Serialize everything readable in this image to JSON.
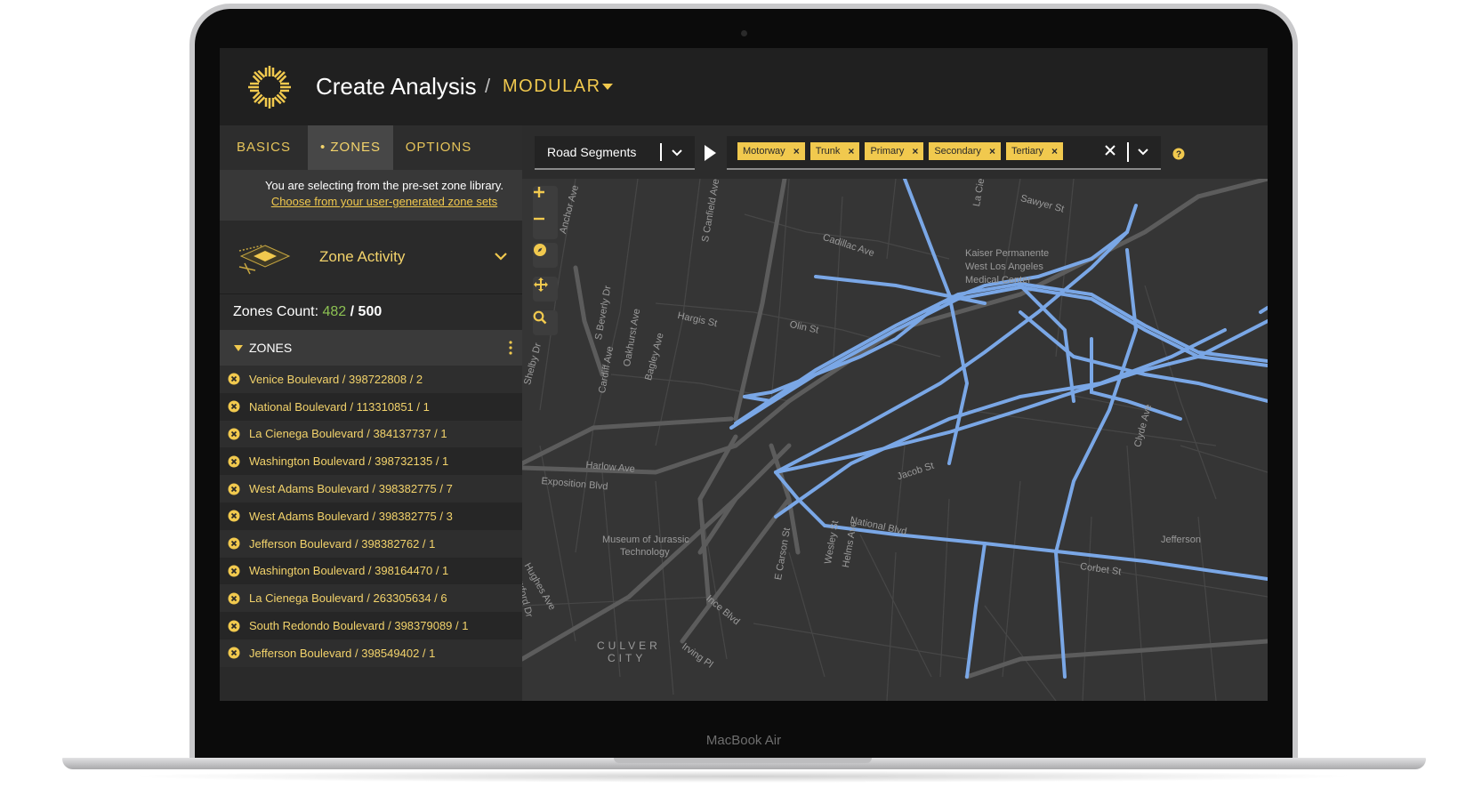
{
  "device": {
    "brand_label": "MacBook Air"
  },
  "header": {
    "title": "Create Analysis",
    "separator": "/",
    "mode": "MODULAR"
  },
  "tabs": [
    {
      "label": "BASICS"
    },
    {
      "label": "• ZONES"
    },
    {
      "label": "OPTIONS"
    }
  ],
  "notice": {
    "text": "You are selecting from the pre-set zone library.",
    "link": "Choose from your user-generated zone sets"
  },
  "activity": {
    "label": "Zone Activity"
  },
  "zones_count": {
    "prefix": "Zones Count: ",
    "current": "482",
    "separator": " / ",
    "max": "500"
  },
  "zones_section": {
    "title": "ZONES"
  },
  "zones": [
    "Venice Boulevard / 398722808 / 2",
    "National Boulevard / 113310851 / 1",
    "La Cienega Boulevard / 384137737 / 1",
    "Washington Boulevard / 398732135 / 1",
    "West Adams Boulevard / 398382775 / 7",
    "West Adams Boulevard / 398382775 / 3",
    "Jefferson Boulevard / 398382762 / 1",
    "Washington Boulevard / 398164470 / 1",
    "La Cienega Boulevard / 263305634 / 6",
    "South Redondo Boulevard / 398379089 / 1",
    "Jefferson Boulevard / 398549402 / 1"
  ],
  "filter": {
    "select_label": "Road Segments",
    "tags": [
      {
        "label": "Motorway",
        "remove": "×"
      },
      {
        "label": "Trunk",
        "remove": "×"
      },
      {
        "label": "Primary",
        "remove": "×"
      },
      {
        "label": "Secondary",
        "remove": "×"
      },
      {
        "label": "Tertiary",
        "remove": "×"
      }
    ]
  },
  "map": {
    "labels": [
      "Anchor Ave",
      "S Canfield Ave",
      "Cadillac Ave",
      "Sawyer St",
      "La Cienega",
      "Kaiser Permanente",
      "West Los Angeles",
      "Medical Center",
      "Hargis St",
      "Olin St",
      "S Beverly Dr",
      "Oakhurst Ave",
      "Bagley Ave",
      "Cardiff Ave",
      "Shelby Dr",
      "Harlow Ave",
      "Exposition Blvd",
      "Jacob St",
      "National Blvd",
      "Clyde Ave",
      "Museum of Jurassic",
      "Technology",
      "Hughes Ave",
      "Duxford Dr",
      "Corbet St",
      "E Carson St",
      "Wesley St",
      "Helms Ave",
      "Ince Blvd",
      "Irving Pl",
      "CULVER",
      "CITY",
      "Jefferson"
    ]
  },
  "colors": {
    "accent": "#f1c94e",
    "highlight_road": "#7aa7e6",
    "count_green": "#8cc152",
    "background": "#2a2a2a"
  },
  "icons": {
    "logo": "sun-burst-icon",
    "activity": "isometric-zone-icon",
    "zone_remove": "circle-x-icon",
    "zoom_in": "plus-icon",
    "zoom_out": "minus-icon",
    "compass": "compass-icon",
    "pan": "move-icon",
    "search": "search-icon",
    "help": "question-icon"
  }
}
